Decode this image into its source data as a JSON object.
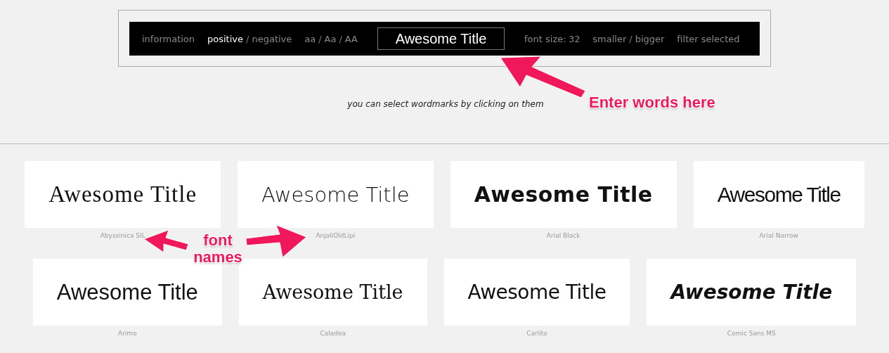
{
  "toolbar": {
    "groups": [
      {
        "items": [
          {
            "kind": "option",
            "label": "information",
            "selected": false
          }
        ]
      },
      {
        "items": [
          {
            "kind": "option",
            "label": "positive",
            "selected": true
          },
          {
            "kind": "separator",
            "label": "/"
          },
          {
            "kind": "option",
            "label": "negative",
            "selected": false
          }
        ]
      },
      {
        "items": [
          {
            "kind": "option",
            "label": "aa",
            "selected": false
          },
          {
            "kind": "separator",
            "label": "/"
          },
          {
            "kind": "option",
            "label": "Aa",
            "selected": false
          },
          {
            "kind": "separator",
            "label": "/"
          },
          {
            "kind": "option",
            "label": "AA",
            "selected": false
          }
        ]
      }
    ],
    "title_input": {
      "value": "Awesome Title"
    },
    "font_size": {
      "label": "font size:",
      "value": "32"
    },
    "size_controls": [
      {
        "kind": "option",
        "label": "smaller",
        "selected": false
      },
      {
        "kind": "separator",
        "label": "/"
      },
      {
        "kind": "option",
        "label": "bigger",
        "selected": false
      }
    ],
    "filter": {
      "label": "filter selected",
      "selected": false
    }
  },
  "hint": "you can select wordmarks by clicking on them",
  "wordmarks": [
    {
      "text": "Awesome Title",
      "font": "Abyssinica SIL"
    },
    {
      "text": "Awesome Title",
      "font": "AnjaliOldLipi"
    },
    {
      "text": "Awesome Title",
      "font": "Arial Black"
    },
    {
      "text": "Awesome Title",
      "font": "Arial Narrow"
    },
    {
      "text": "Awesome Title",
      "font": "Arimo"
    },
    {
      "text": "Awesome Title",
      "font": "Caladea"
    },
    {
      "text": "Awesome Title",
      "font": "Carlito"
    },
    {
      "text": "Awesome Title",
      "font": "Comic Sans MS"
    }
  ],
  "annotations": [
    {
      "text": "Enter words here"
    },
    {
      "text": "font names"
    }
  ]
}
